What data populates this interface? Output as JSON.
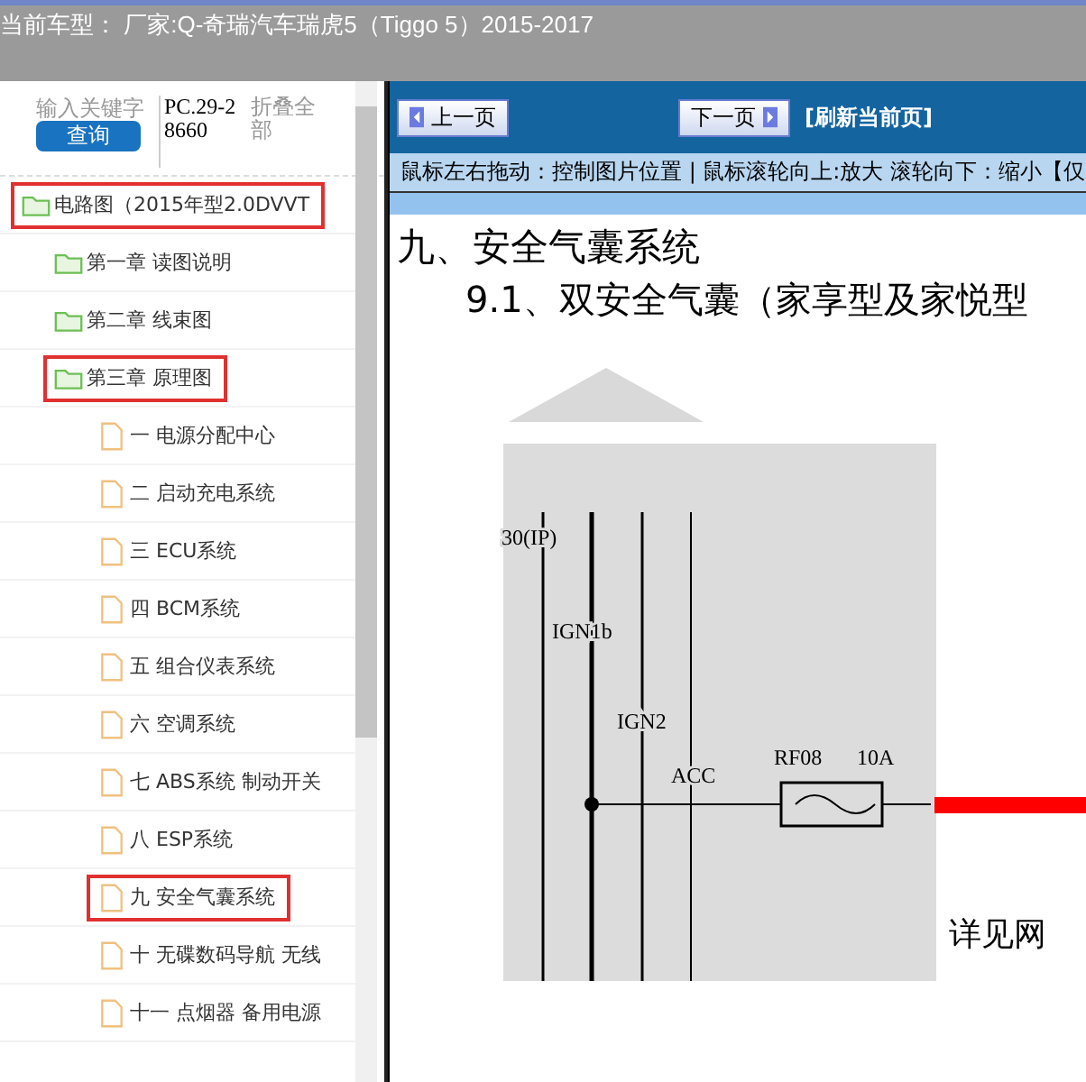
{
  "title_bar": {
    "text": "当前车型： 厂家:Q-奇瑞汽车瑞虎5（Tiggo 5）2015-2017"
  },
  "sidebar": {
    "search": {
      "placeholder": "输入关键字"
    },
    "search_button": "查询",
    "code": "PC.29-28660",
    "collapse_all": "折叠全部",
    "tree": [
      {
        "label": "电路图（2015年型2.0DVVT",
        "kind": "folder",
        "marked": true,
        "children": [
          {
            "label": "第一章 读图说明",
            "kind": "folder",
            "marked": false
          },
          {
            "label": "第二章 线束图",
            "kind": "folder",
            "marked": false
          },
          {
            "label": "第三章 原理图",
            "kind": "folder",
            "marked": true,
            "children": [
              {
                "label": "一 电源分配中心",
                "kind": "page",
                "marked": false
              },
              {
                "label": "二 启动充电系统",
                "kind": "page",
                "marked": false
              },
              {
                "label": "三 ECU系统",
                "kind": "page",
                "marked": false
              },
              {
                "label": "四 BCM系统",
                "kind": "page",
                "marked": false
              },
              {
                "label": "五 组合仪表系统",
                "kind": "page",
                "marked": false
              },
              {
                "label": "六 空调系统",
                "kind": "page",
                "marked": false
              },
              {
                "label": "七 ABS系统 制动开关",
                "kind": "page",
                "marked": false
              },
              {
                "label": "八 ESP系统",
                "kind": "page",
                "marked": false
              },
              {
                "label": "九 安全气囊系统",
                "kind": "page",
                "marked": true
              },
              {
                "label": "十 无碟数码导航 无线",
                "kind": "page",
                "marked": false
              },
              {
                "label": "十一 点烟器 备用电源",
                "kind": "page",
                "marked": false
              }
            ]
          }
        ]
      }
    ]
  },
  "viewer": {
    "prev_button": "上一页",
    "next_button": "下一页",
    "refresh_link": "[刷新当前页]",
    "hint": "鼠标左右拖动：控制图片位置 | 鼠标滚轮向上:放大  滚轮向下：缩小【仅",
    "heading": "九、安全气囊系统",
    "subheading": "9.1、双安全气囊（家享型及家悦型",
    "diagram": {
      "labels": [
        "30(IP)",
        "IGN1b",
        "IGN2",
        "ACC"
      ],
      "fuse": "RF08",
      "rating": "10A",
      "note": "详见网"
    }
  }
}
